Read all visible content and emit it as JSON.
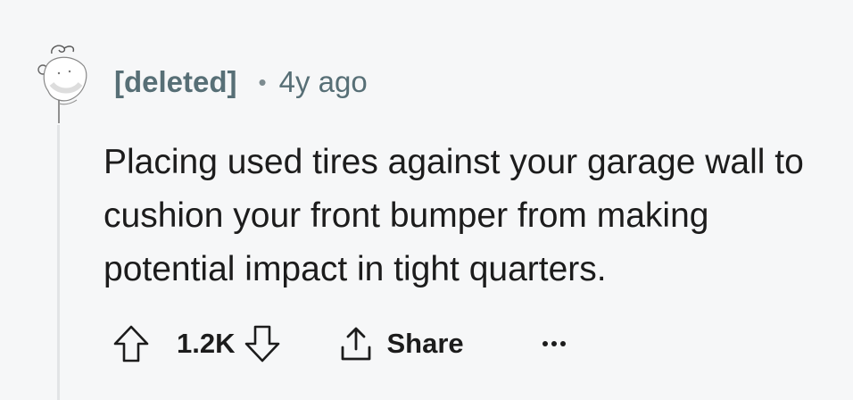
{
  "comment": {
    "author": "[deleted]",
    "separator": "•",
    "time_ago": "4y ago",
    "body": "Placing used tires against your garage wall to cushion your front bumper from making potential impact in tight quarters.",
    "score": "1.2K",
    "share_label": "Share"
  },
  "icons": {
    "avatar": "snoo-avatar-icon",
    "upvote": "upvote-arrow-icon",
    "downvote": "downvote-arrow-icon",
    "share": "share-icon",
    "more": "more-options-icon"
  },
  "colors": {
    "background": "#f6f7f8",
    "meta_text": "#576f76",
    "body_text": "#1c1c1c",
    "thread_line": "#e2e4e6"
  }
}
